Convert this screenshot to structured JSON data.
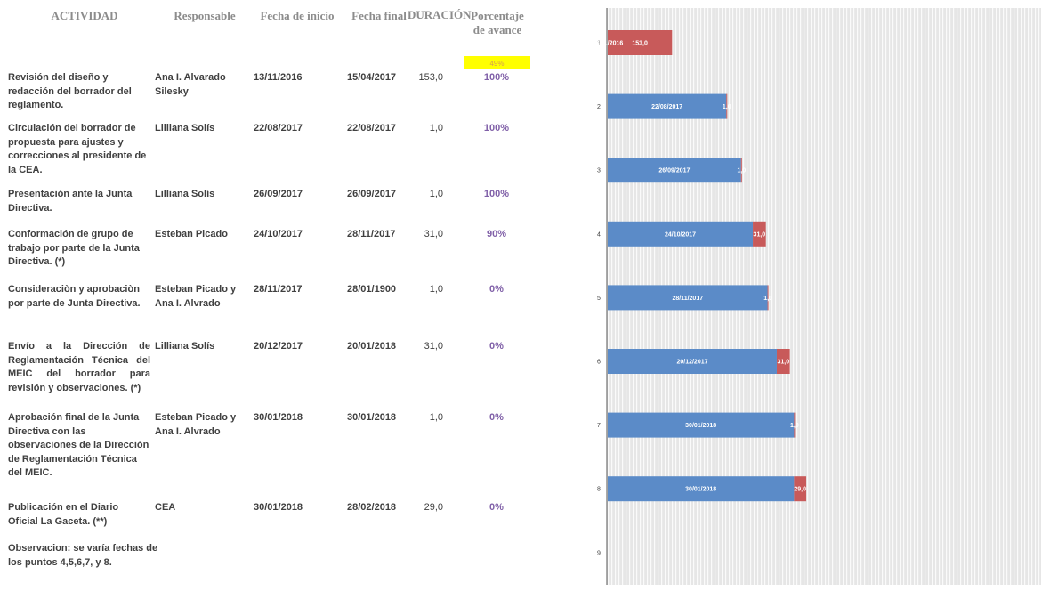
{
  "headers": {
    "actividad": "ACTIVIDAD",
    "responsable": "Responsable",
    "fecha_inicio": "Fecha de inicio",
    "fecha_final": "Fecha final",
    "duracion": "DURACIÓN",
    "porcentaje": "Porcentaje de avance"
  },
  "summary_percent": "49%",
  "rows": [
    {
      "actividad": "Revisión del diseño y redacción del borrador del reglamento.",
      "responsable": "Ana I. Alvarado Silesky",
      "fecha_inicio": "13/11/2016",
      "fecha_final": "15/04/2017",
      "duracion": "153,0",
      "avance": "100%"
    },
    {
      "actividad": "Circulación del borrador de propuesta para ajustes y correcciones al presidente de la CEA.",
      "responsable": "Lilliana Solís",
      "fecha_inicio": "22/08/2017",
      "fecha_final": "22/08/2017",
      "duracion": "1,0",
      "avance": "100%"
    },
    {
      "actividad": "Presentación ante la Junta Directiva.",
      "responsable": "Lilliana Solís",
      "fecha_inicio": "26/09/2017",
      "fecha_final": "26/09/2017",
      "duracion": "1,0",
      "avance": "100%"
    },
    {
      "actividad": "Conformación de grupo de trabajo por parte de la Junta Directiva. (*)",
      "responsable": "Esteban Picado",
      "fecha_inicio": "24/10/2017",
      "fecha_final": "28/11/2017",
      "duracion": "31,0",
      "avance": "90%"
    },
    {
      "actividad": "Consideraciòn y aprobaciòn por parte de Junta Directiva.",
      "responsable": "Esteban Picado y Ana I. Alvrado",
      "fecha_inicio": "28/11/2017",
      "fecha_final": "28/01/1900",
      "duracion": "1,0",
      "avance": "0%"
    },
    {
      "actividad": "Envío a la Dirección de Reglamentación Técnica del MEIC del borrador para revisión y observaciones. (*)",
      "responsable": "Lilliana Solís",
      "fecha_inicio": "20/12/2017",
      "fecha_final": "20/01/2018",
      "duracion": "31,0",
      "avance": "0%"
    },
    {
      "actividad": "Aprobación final de la Junta Directiva con las observaciones de la Dirección de Reglamentación Técnica del MEIC.",
      "responsable": "Esteban Picado y Ana I. Alvrado",
      "fecha_inicio": "30/01/2018",
      "fecha_final": "30/01/2018",
      "duracion": "1,0",
      "avance": "0%"
    },
    {
      "actividad": "Publicación en el Diario Oficial La Gaceta. (**)",
      "responsable": "CEA",
      "fecha_inicio": "30/01/2018",
      "fecha_final": "28/02/2018",
      "duracion": "29,0",
      "avance": "0%"
    }
  ],
  "note": "Observacion: se varía fechas de los puntos 4,5,6,7, y 8.",
  "chart_data": {
    "type": "bar",
    "orientation": "horizontal",
    "stacked": true,
    "categories": [
      "1",
      "2",
      "3",
      "4",
      "5",
      "6",
      "7",
      "8",
      "9"
    ],
    "series": [
      {
        "role": "start",
        "color": "#5b8bc8",
        "values": [
          "13/11/2016",
          "22/08/2017",
          "26/09/2017",
          "24/10/2017",
          "28/11/2017",
          "20/12/2017",
          "30/01/2018",
          "30/01/2018",
          null
        ]
      },
      {
        "role": "duration",
        "color": "#c85a5a",
        "values": [
          153,
          1,
          1,
          31,
          1,
          31,
          1,
          29,
          null
        ],
        "labels": [
          "153,0",
          "1,0",
          "1,0",
          "31,0",
          "1,0",
          "31,0",
          "1,0",
          "29,0",
          ""
        ]
      }
    ],
    "colors": {
      "plot_background": "#e8e8e8",
      "gridlines": "#ffffff"
    }
  }
}
